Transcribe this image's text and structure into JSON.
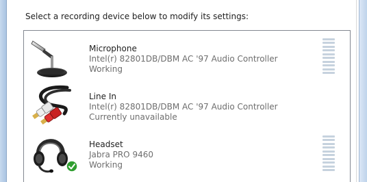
{
  "instruction": "Select a recording device below to modify its settings:",
  "devices": [
    {
      "name": "Microphone",
      "driver": "Intel(r) 82801DB/DBM AC '97 Audio Controller",
      "status": "Working",
      "icon": "microphone-icon",
      "show_meter": true,
      "level": 0
    },
    {
      "name": "Line In",
      "driver": "Intel(r) 82801DB/DBM AC '97 Audio Controller",
      "status": "Currently unavailable",
      "icon": "line-in-cable-icon",
      "show_meter": false
    },
    {
      "name": "Headset",
      "driver": "Jabra PRO 9460",
      "status": "Working",
      "icon": "headset-icon",
      "default_badge": "checkmark-icon",
      "show_meter": true,
      "level": 0
    }
  ],
  "colors": {
    "frame": "#aac4e2",
    "list_border": "#828790",
    "secondary_text": "#6d6d6d",
    "meter_segment": "#c6d2de",
    "default_check": "#2f9e2f"
  }
}
